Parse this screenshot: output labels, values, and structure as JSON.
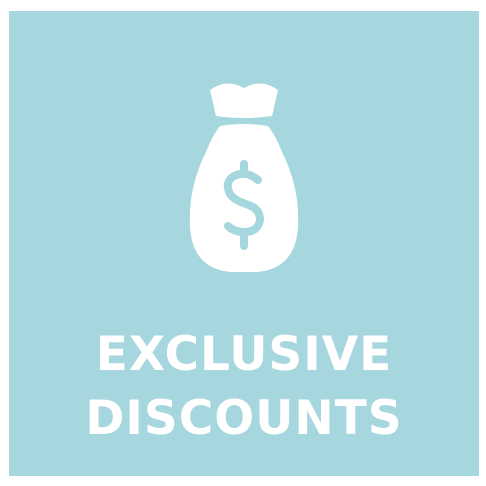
{
  "tile": {
    "background_color": "#a6d7de",
    "foreground_color": "#ffffff",
    "icon": "money-bag-dollar-icon",
    "title_line_1": "EXCLUSIVE",
    "title_line_2": "DISCOUNTS"
  }
}
